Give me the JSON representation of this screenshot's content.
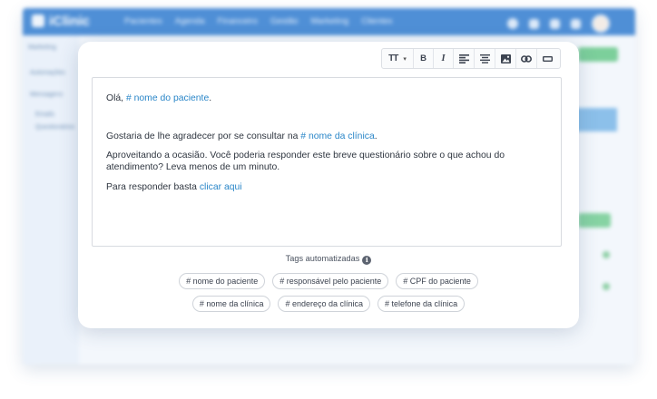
{
  "background_app": {
    "logo_text": "iClinic",
    "nav_items": [
      "Pacientes",
      "Agenda",
      "Financeiro",
      "Gestão",
      "Marketing",
      "Clientes"
    ],
    "sidebar_items": [
      "Marketing",
      "Automações",
      "Mensagens",
      "Emails",
      "Questionários"
    ],
    "colors": {
      "topbar": "#4f8fd6",
      "accent_green": "#7ccf9b"
    }
  },
  "toolbar": {
    "text_size_label": "TT",
    "bold_label": "B",
    "italic_label": "I",
    "icons": [
      "align-left-icon",
      "align-center-icon",
      "image-icon",
      "link-icon",
      "horizontal-rule-icon"
    ]
  },
  "editor": {
    "greeting": "Olá, ",
    "greeting_tag": "# nome do paciente",
    "greeting_end": ".",
    "thanks": "Gostaria de lhe agradecer por se consultar na ",
    "thanks_tag": "# nome da clínica",
    "thanks_end": ".",
    "survey": "Aproveitando a ocasião. Você poderia responder este breve questionário sobre o que achou do atendimento? Leva menos de um minuto.",
    "respond": "Para responder basta ",
    "respond_link": "clicar aqui",
    "link_color": "#2a86c8"
  },
  "tags": {
    "heading": "Tags automatizadas",
    "info_glyph": "i",
    "row1": [
      "# nome do paciente",
      "# responsável pelo paciente",
      "# CPF do paciente"
    ],
    "row2": [
      "# nome da clínica",
      "# endereço da clínica",
      "# telefone da clínica"
    ]
  }
}
